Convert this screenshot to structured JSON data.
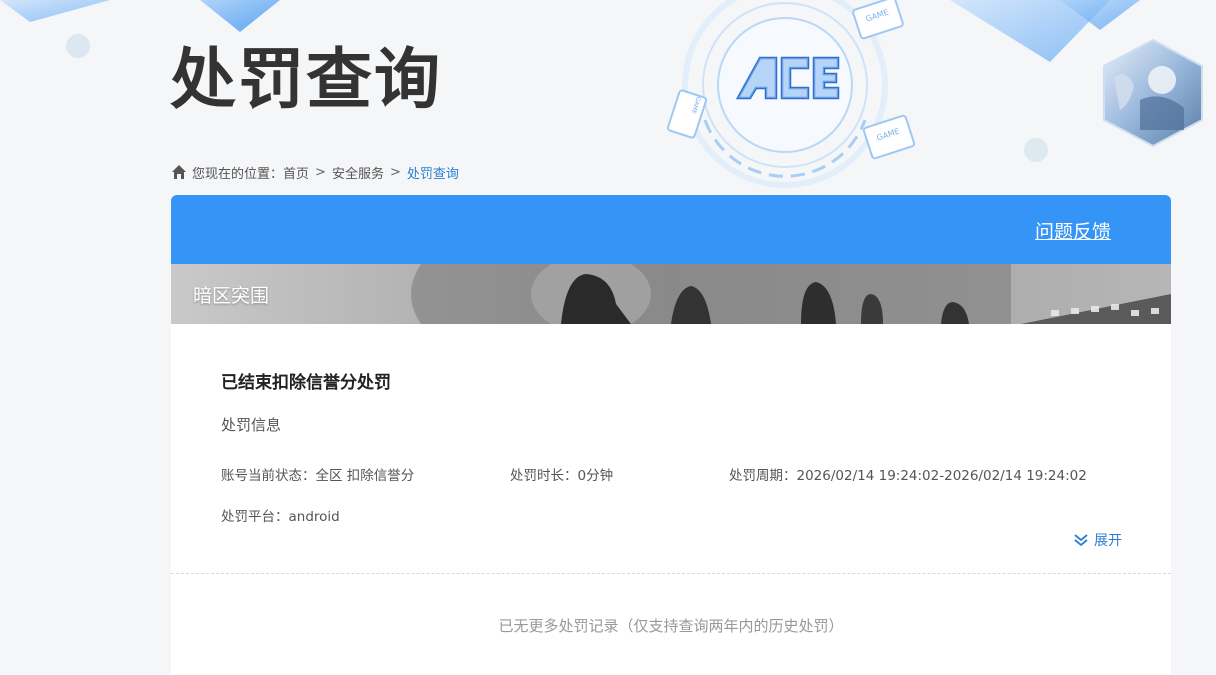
{
  "page": {
    "title": "处罚查询",
    "logo_text": "ACE",
    "game_badge": "GAME"
  },
  "breadcrumb": {
    "prefix": "您现在的位置：",
    "items": [
      "首页",
      "安全服务",
      "处罚查询"
    ],
    "separator": ">"
  },
  "header": {
    "feedback_label": "问题反馈"
  },
  "game": {
    "name": "暗区突围"
  },
  "record": {
    "title": "已结束扣除信誉分处罚",
    "section_label": "处罚信息",
    "status": "账号当前状态：全区 扣除信誉分",
    "duration": "处罚时长：0分钟",
    "period": "处罚周期：2026/02/14 19:24:02-2026/02/14 19:24:02",
    "platform": "处罚平台：android",
    "expand_label": "展开"
  },
  "footer_note": "已无更多处罚记录（仅支持查询两年内的历史处罚）",
  "colors": {
    "accent": "#3595f6",
    "link": "#2a7fd4",
    "background": "#f5f6f8"
  },
  "icons": [
    "home-icon",
    "ace-logo",
    "game-badge-icon",
    "double-chevron-down-icon",
    "avatar"
  ]
}
